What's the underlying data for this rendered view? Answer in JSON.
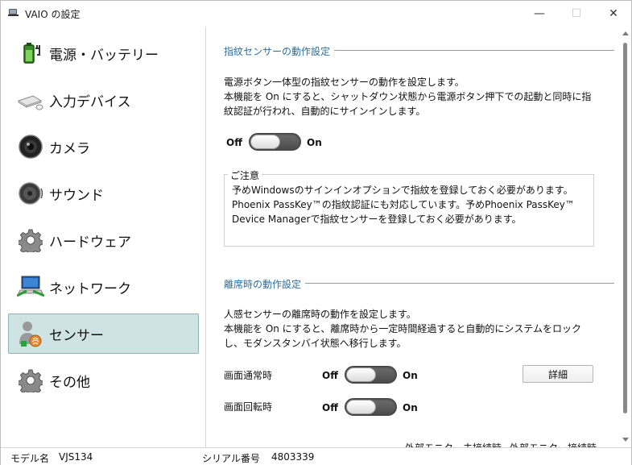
{
  "window": {
    "title": "VAIO の設定",
    "minimize_glyph": "—",
    "maximize_glyph": "☐",
    "close_glyph": "✕"
  },
  "sidebar": {
    "items": [
      {
        "label": "電源・バッテリー",
        "icon": "battery-icon"
      },
      {
        "label": "入力デバイス",
        "icon": "keyboard-mouse-icon"
      },
      {
        "label": "カメラ",
        "icon": "camera-icon"
      },
      {
        "label": "サウンド",
        "icon": "speaker-icon"
      },
      {
        "label": "ハードウェア",
        "icon": "gear-icon"
      },
      {
        "label": "ネットワーク",
        "icon": "network-icon"
      },
      {
        "label": "センサー",
        "icon": "sensor-icon",
        "active": true
      },
      {
        "label": "その他",
        "icon": "gear-icon"
      }
    ]
  },
  "fingerprint": {
    "title": "指紋センサーの動作設定",
    "desc_line1": "電源ボタン一体型の指紋センサーの動作を設定します。",
    "desc_line2": "本機能を On にすると、シャットダウン状態から電源ボタン押下での起動と同時に指",
    "desc_line3": "紋認証が行われ、自動的にサインインします。",
    "toggle_off": "Off",
    "toggle_on": "On",
    "toggle_state": "off",
    "notice_title": "ご注意",
    "notice_line1": "予めWindowsのサインインオプションで指紋を登録しておく必要があります。",
    "notice_line2": "Phoenix PassKey™の指紋認証にも対応しています。予めPhoenix PassKey™",
    "notice_line3": "Device Managerで指紋センサーを登録しておく必要があります。"
  },
  "away": {
    "title": "離席時の動作設定",
    "desc_line1": "人感センサーの離席時の動作を設定します。",
    "desc_line2": "本機能を On にすると、離席時から一定時間経過すると自動的にシステムをロック",
    "desc_line3": "し、モダンスタンバイ状態へ移行します。",
    "row1_label": "画面通常時",
    "row2_label": "画面回転時",
    "toggle_off": "Off",
    "toggle_on": "On",
    "row1_state": "off",
    "row2_state": "off",
    "detail_button": "詳細",
    "cut_text_left": "外部モニター未接続時",
    "cut_text_right": "外部モニター接続時"
  },
  "statusbar": {
    "model_label": "モデル名",
    "model_value": "VJS134",
    "serial_label": "シリアル番号",
    "serial_value": "4803339"
  },
  "colors": {
    "accent_title": "#2b6ea0",
    "active_nav_bg": "#cfe3e4",
    "toggle_track": "#555555"
  }
}
